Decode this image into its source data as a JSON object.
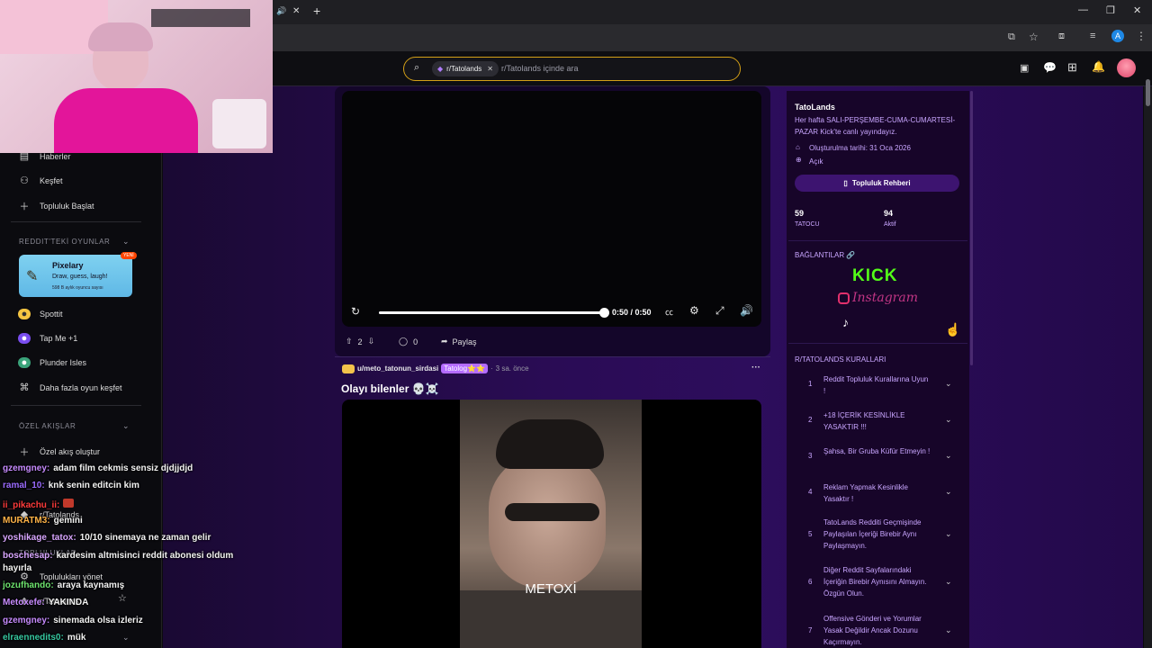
{
  "browser": {
    "tab_sound_icon": "speaker-icon",
    "tab_close": "✕",
    "new_tab": "+",
    "profile_initial": "A"
  },
  "search": {
    "chip": "r/Tatolands",
    "placeholder": "r/Tatolands içinde ara"
  },
  "leftnav": {
    "items_top": [
      {
        "label": "Haberler",
        "icon": "news-icon"
      },
      {
        "label": "Keşfet",
        "icon": "explore-icon"
      },
      {
        "label": "Topluluk Başlat",
        "icon": "plus-icon"
      }
    ],
    "games_header": "REDDIT'TEKİ OYUNLAR",
    "featured_game": {
      "title": "Pixelary",
      "subtitle": "Draw, guess, laugh!",
      "meta": "598 B aylık oyuncu sayısı",
      "badge": "YENİ"
    },
    "games": [
      "Spottit",
      "Tap Me +1",
      "Plunder Isles"
    ],
    "more_games": "Daha fazla oyun keşfet",
    "feeds_header": "ÖZEL AKIŞLAR",
    "create_feed": "Özel akış oluştur",
    "recent_community": "r/Tatolands",
    "communities_header": "TOPLULUKLAR",
    "manage_communities": "Toplulukları yönet",
    "community": "r/Tatolands"
  },
  "chat": [
    {
      "user": "gzemgney:",
      "color": "#c78bff",
      "msg": "adam film cekmis sensiz djdjjdjd"
    },
    {
      "user": "ramal_10:",
      "color": "#9b6bff",
      "msg": "knk senin editcin kim"
    },
    {
      "user": "ii_pikachu_ii:",
      "color": "#ff3b3b",
      "msg": ""
    },
    {
      "user": "MURATM3:",
      "color": "#ffb347",
      "msg": "gemini"
    },
    {
      "user": "yoshikage_tatox:",
      "color": "#d8a6ff",
      "msg": "10/10 sinemaya ne zaman gelir"
    },
    {
      "user": "boschesap:",
      "color": "#d8a6ff",
      "msg": "kardesim altmisinci reddit abonesi oldum"
    },
    {
      "user": "",
      "color": "#ffffff",
      "msg": "hayırla"
    },
    {
      "user": "jozufhando:",
      "color": "#6de36d",
      "msg": "araya kaynamış"
    },
    {
      "user": "Metoxefe:",
      "color": "#c78bff",
      "msg": "YAKINDA"
    },
    {
      "user": "gzemgney:",
      "color": "#c78bff",
      "msg": "sinemada olsa izleriz"
    },
    {
      "user": "elraennedits0:",
      "color": "#36c7a0",
      "msg": "mük"
    }
  ],
  "video1": {
    "time": "0:50 / 0:50",
    "progress": 1.0,
    "votes": "2",
    "comments": "0",
    "share": "Paylaş"
  },
  "post2": {
    "author": "u/meto_tatonun_sirdasi",
    "flair": "Tatolog⭐⭐",
    "time": "3 sa. önce",
    "more": "···",
    "title": "Olayı bilenler 💀☠️",
    "caption": "METOXİ"
  },
  "sidebar": {
    "name": "TatoLands",
    "desc": "Her hafta SALI-PERŞEMBE-CUMA-CUMARTESİ-PAZAR Kick'te canlı yayındayız.",
    "created": "Oluşturulma tarihi: 31 Oca 2026",
    "visibility": "Açık",
    "guide_button": "Topluluk Rehberi",
    "members_count": "59",
    "members_label": "TATOCU",
    "active_count": "94",
    "active_label": "Aktif",
    "links_header": "BAĞLANTILAR 🔗",
    "kick": "KICK",
    "instagram": "Instagram",
    "rules_header": "R/TATOLANDS KURALLARI",
    "rules": [
      {
        "num": "1",
        "text": "Reddit Topluluk Kurallarına Uyun !"
      },
      {
        "num": "2",
        "text": "+18 İÇERİK KESİNLİKLE YASAKTIR !!!"
      },
      {
        "num": "3",
        "text": "Şahsa, Bir Gruba Küfür Etmeyin !"
      },
      {
        "num": "4",
        "text": "Reklam Yapmak Kesinlikle Yasaktır !"
      },
      {
        "num": "5",
        "text": "TatoLands Redditi Geçmişinde Paylaşılan İçeriği Birebir Aynı Paylaşmayın."
      },
      {
        "num": "6",
        "text": "Diğer Reddit Sayfalarındaki İçeriğin Birebir Aynısını Almayın. Özgün Olun."
      },
      {
        "num": "7",
        "text": "Offensive Gönderi ve Yorumlar Yasak Değildir Ancak Dozunu Kaçırmayın."
      }
    ]
  }
}
